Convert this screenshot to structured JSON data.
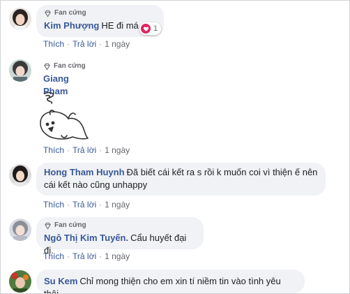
{
  "badge_label": "Fan cứng",
  "comments": [
    {
      "author": "Kim Phượng",
      "text": "HE đi má",
      "reaction_count": "1",
      "actions": {
        "like": "Thích",
        "reply": "Trả lời",
        "time": "1 ngày"
      }
    },
    {
      "author": "Giang Pham",
      "text": "",
      "actions": {
        "like": "Thích",
        "reply": "Trả lời",
        "time": "1 ngày"
      }
    },
    {
      "author": "Hong Tham Huynh",
      "text": "Đã biết cái kết ra s rồi k muốn coi vì thiện ế nên cái kết nào cũng unhappy",
      "actions": {
        "like": "Thích",
        "reply": "Trả lời",
        "time": "1 ngày"
      }
    },
    {
      "author": "Ngô Thị Kim Tuyến.",
      "text": "Cẩu huyết đại đi.",
      "actions": {
        "like": "Thích",
        "reply": "Trả lời",
        "time": "1 ngày"
      }
    },
    {
      "author": "Su Kem",
      "text": "Chỉ mong thiện cho em xin tí niềm tin vào tình yêu thôi"
    }
  ],
  "colors": {
    "author": "#385898",
    "bubble": "#f0f2f5",
    "heart": "#e0245e",
    "meta": "#65676b"
  },
  "icons": {
    "badge": "diamond-icon",
    "reaction": "heart-icon",
    "sticker": "cartoon-pig-sticker"
  }
}
